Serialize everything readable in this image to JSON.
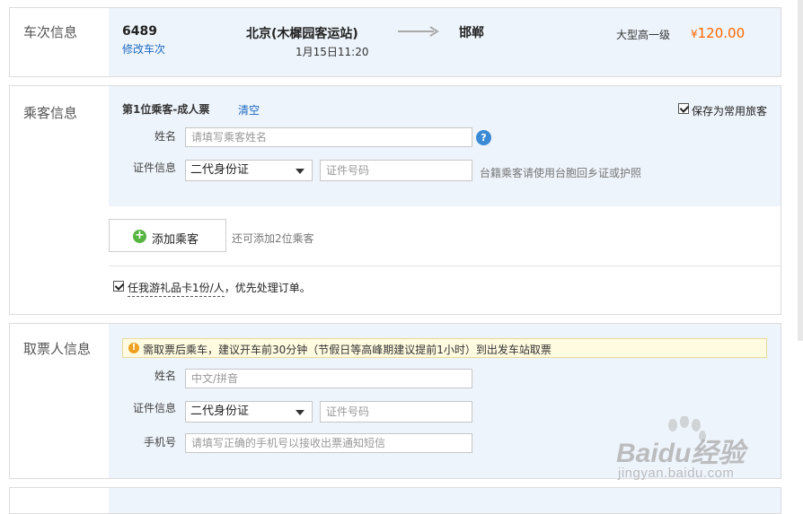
{
  "train": {
    "section_label": "车次信息",
    "number": "6489",
    "modify_label": "修改车次",
    "from_station": "北京(木樨园客运站)",
    "depart_time": "1月15日11:20",
    "to_station": "邯郸",
    "seat_type": "大型高一级",
    "currency": "¥",
    "price": "120.00"
  },
  "passenger": {
    "section_label": "乘客信息",
    "heading": "第1位乘客-成人票",
    "clear_label": "清空",
    "save_frequent_label": "保存为常用旅客",
    "name_label": "姓名",
    "name_placeholder": "请填写乘客姓名",
    "id_label": "证件信息",
    "id_type": "二代身份证",
    "id_placeholder": "证件号码",
    "id_hint": "台籍乘客请使用台胞回乡证或护照",
    "add_button_label": "添加乘客",
    "add_hint": "还可添加2位乘客",
    "gift_text": "任我游礼品卡1份/人",
    "gift_suffix": "，优先处理订单。"
  },
  "pickup": {
    "section_label": "取票人信息",
    "notice": "需取票后乘车，建议开车前30分钟（节假日等高峰期建议提前1小时）到出发车站取票",
    "name_label": "姓名",
    "name_placeholder": "中文/拼音",
    "id_label": "证件信息",
    "id_type": "二代身份证",
    "id_placeholder": "证件号码",
    "phone_label": "手机号",
    "phone_placeholder": "请填写正确的手机号以接收出票通知短信"
  },
  "watermark": {
    "brand": "Baidu经验",
    "url": "jingyan.baidu.com"
  },
  "colors": {
    "price": "#ff6600",
    "link": "#1b6ac0",
    "section_bg": "#eef4fb",
    "notice_bg": "#fffbe0",
    "notice_icon": "#f0a020",
    "help_icon": "#3a8ad6",
    "add_icon": "#56b440"
  }
}
